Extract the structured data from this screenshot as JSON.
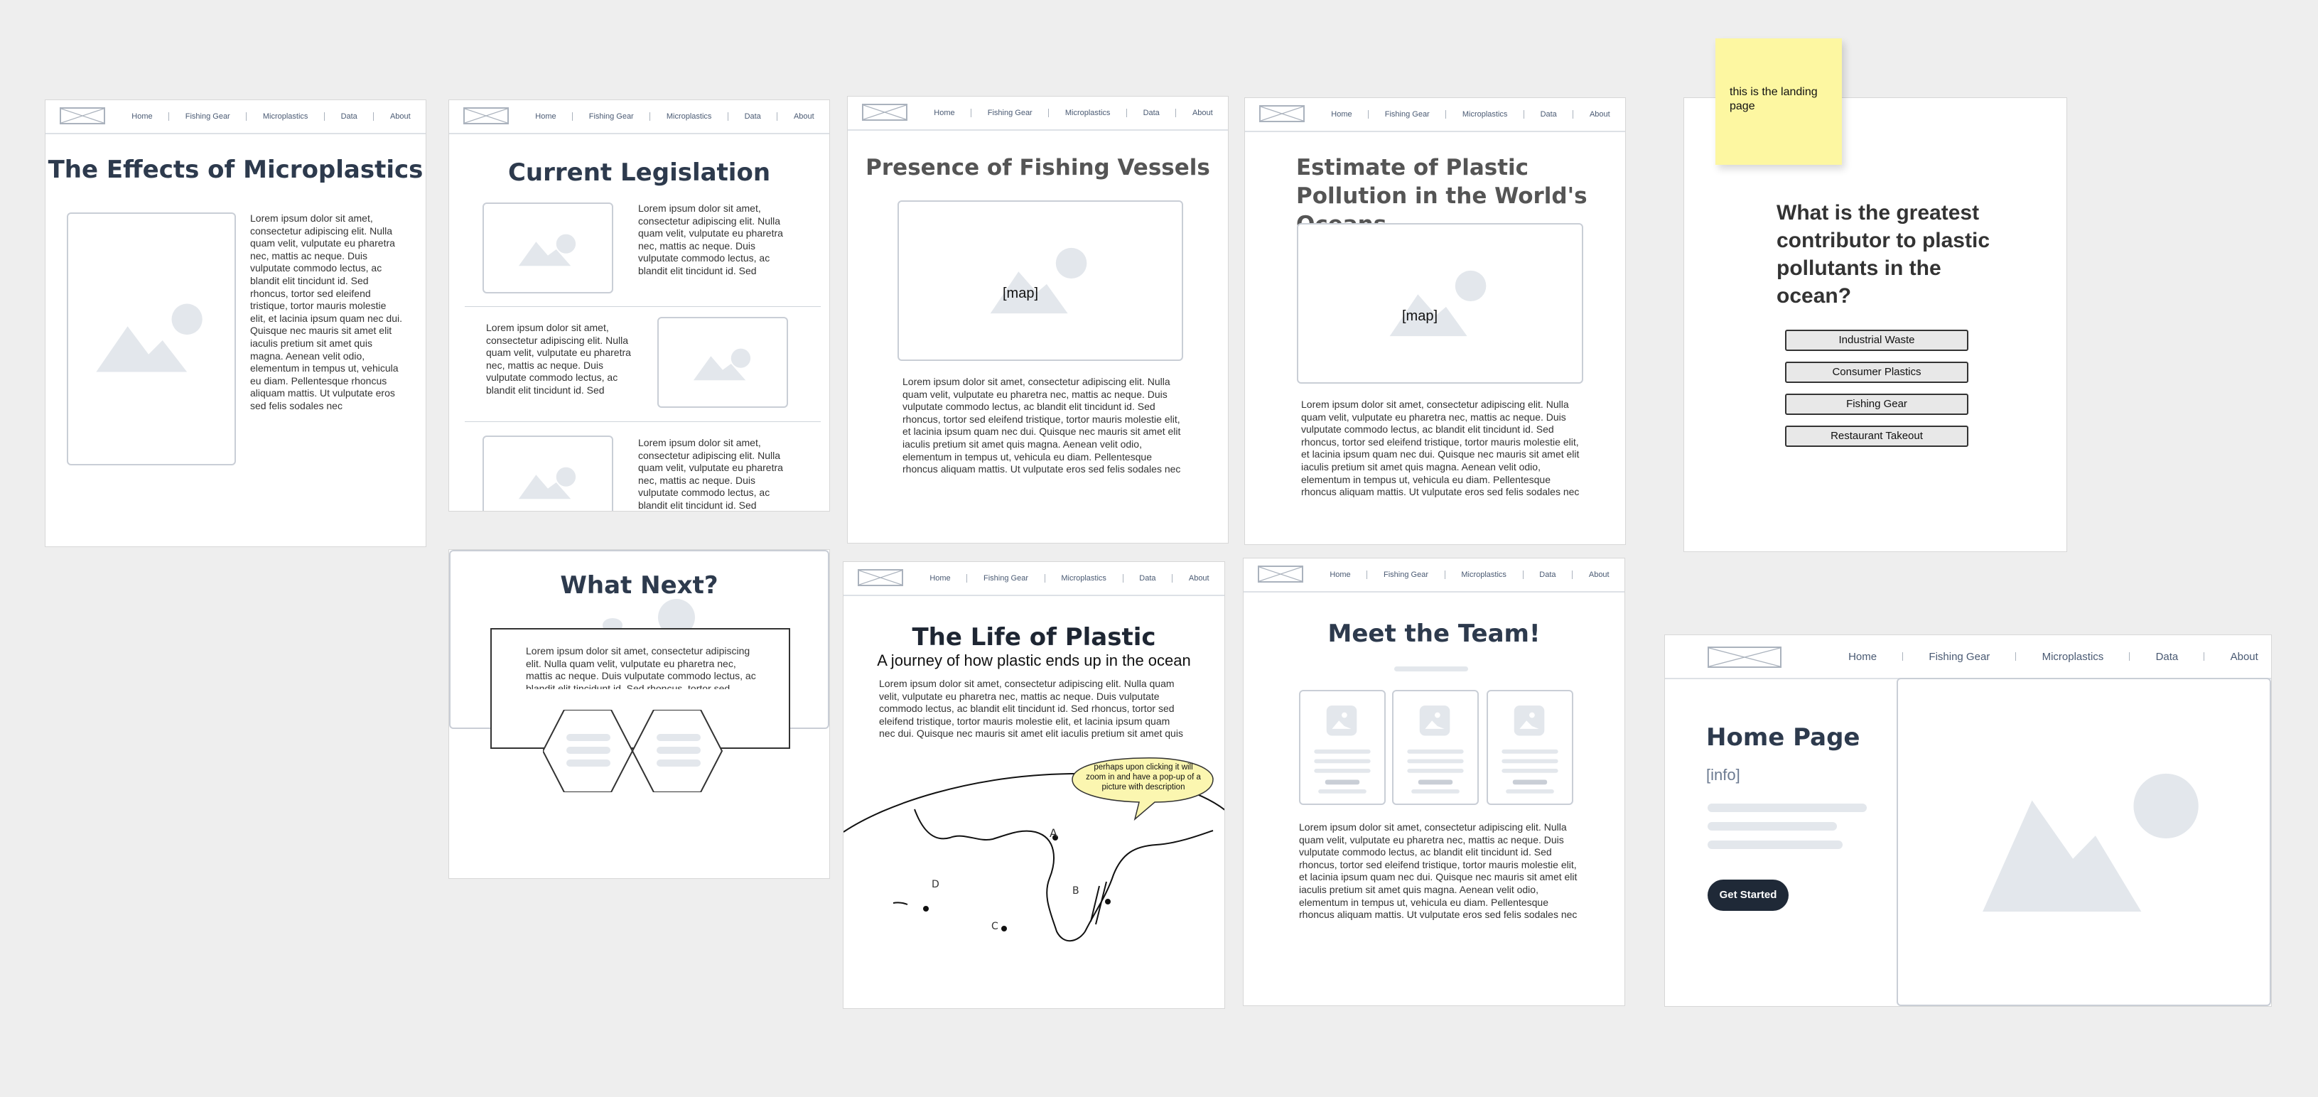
{
  "nav": {
    "home": "Home",
    "fishing_gear": "Fishing Gear",
    "microplastics": "Microplastics",
    "data": "Data",
    "about": "About"
  },
  "frames": {
    "effects": {
      "title": "The Effects of Microplastics",
      "body": "Lorem ipsum dolor sit amet, consectetur adipiscing elit. Nulla quam velit, vulputate eu pharetra nec, mattis ac neque. Duis vulputate commodo lectus, ac blandit elit tincidunt id. Sed rhoncus, tortor sed eleifend tristique, tortor mauris molestie elit, et lacinia ipsum quam nec dui. Quisque nec mauris sit amet elit iaculis pretium sit amet quis magna. Aenean velit odio, elementum in tempus ut, vehicula eu diam. Pellentesque rhoncus aliquam mattis. Ut vulputate eros sed felis sodales nec"
    },
    "legislation": {
      "title": "Current Legislation",
      "body": "Lorem ipsum dolor sit amet, consectetur adipiscing elit. Nulla quam velit, vulputate eu pharetra nec, mattis ac neque. Duis vulputate commodo lectus, ac blandit elit tincidunt id. Sed rhoncus, tortor sed eleifend"
    },
    "what_next": {
      "title": "What Next?",
      "body": "Lorem ipsum dolor sit amet, consectetur adipiscing elit. Nulla quam velit, vulputate eu pharetra nec, mattis ac neque. Duis vulputate commodo lectus, ac blandit elit tincidunt id. Sed rhoncus, tortor sed"
    },
    "vessels": {
      "title": "Presence of Fishing Vessels",
      "map_label": "[map]",
      "body": "Lorem ipsum dolor sit amet, consectetur adipiscing elit. Nulla quam velit, vulputate eu pharetra nec, mattis ac neque. Duis vulputate commodo lectus, ac blandit elit tincidunt id. Sed rhoncus, tortor sed eleifend tristique, tortor mauris molestie elit, et lacinia ipsum quam nec dui. Quisque nec mauris sit amet elit iaculis pretium sit amet quis magna. Aenean velit odio, elementum in tempus ut, vehicula eu diam. Pellentesque rhoncus aliquam mattis. Ut vulputate eros sed felis sodales nec"
    },
    "life": {
      "title": "The Life of Plastic",
      "subtitle": "A journey of how plastic ends up in the ocean",
      "body": "Lorem ipsum dolor sit amet, consectetur adipiscing elit. Nulla quam velit, vulputate eu pharetra nec, mattis ac neque. Duis vulputate commodo lectus, ac blandit elit tincidunt id. Sed rhoncus, tortor sed eleifend tristique, tortor mauris molestie elit, et lacinia ipsum quam nec dui. Quisque nec mauris sit amet elit iaculis pretium sit amet quis",
      "bubble": "perhaps upon clicking it will zoom in and have a pop-up of a picture with description",
      "map_labels": [
        "A",
        "B",
        "C",
        "D"
      ]
    },
    "estimate": {
      "title": "Estimate of Plastic Pollution in the World's Oceans",
      "map_label": "[map]",
      "body": "Lorem ipsum dolor sit amet, consectetur adipiscing elit. Nulla quam velit, vulputate eu pharetra nec, mattis ac neque. Duis vulputate commodo lectus, ac blandit elit tincidunt id. Sed rhoncus, tortor sed eleifend tristique, tortor mauris molestie elit, et lacinia ipsum quam nec dui. Quisque nec mauris sit amet elit iaculis pretium sit amet quis magna. Aenean velit odio, elementum in tempus ut, vehicula eu diam. Pellentesque rhoncus aliquam mattis. Ut vulputate eros sed felis sodales nec"
    },
    "team": {
      "title": "Meet the Team!",
      "body": "Lorem ipsum dolor sit amet, consectetur adipiscing elit. Nulla quam velit, vulputate eu pharetra nec, mattis ac neque. Duis vulputate commodo lectus, ac blandit elit tincidunt id. Sed rhoncus, tortor sed eleifend tristique, tortor mauris molestie elit, et lacinia ipsum quam nec dui. Quisque nec mauris sit amet elit iaculis pretium sit amet quis magna. Aenean velit odio, elementum in tempus ut, vehicula eu diam. Pellentesque rhoncus aliquam mattis. Ut vulputate eros sed felis sodales nec"
    },
    "landing": {
      "sticky": "this is the landing page",
      "question": "What is the greatest contributor to plastic pollutants in the ocean?",
      "options": [
        "Industrial Waste",
        "Consumer Plastics",
        "Fishing Gear",
        "Restaurant Takeout"
      ]
    },
    "home": {
      "title": "Home Page",
      "info": "[info]",
      "cta": "Get Started"
    }
  },
  "colors": {
    "canvas": "#eeeeee",
    "heading": "#2d3a4d",
    "nav_text": "#4a5a73",
    "placeholder": "#e3e7ec",
    "sticky": "#fdf7a1",
    "bubble": "#fbf6b0",
    "cta": "#1f2937"
  }
}
